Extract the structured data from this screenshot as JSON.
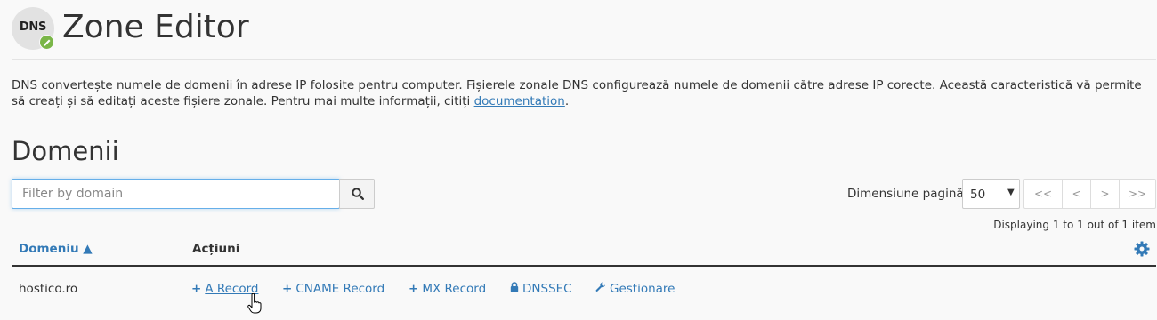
{
  "header": {
    "logo_text": "DNS",
    "title": "Zone Editor"
  },
  "description": {
    "text": "DNS convertește numele de domenii în adrese IP folosite pentru computer. Fișierele zonale DNS configurează numele de domenii către adrese IP corecte. Această caracteristică vă permite să creați și să editați aceste fișiere zonale. Pentru mai multe informații, citiți ",
    "link_text": "documentation",
    "end": "."
  },
  "section": {
    "title": "Domenii"
  },
  "search": {
    "placeholder": "Filter by domain",
    "value": ""
  },
  "pagination": {
    "page_size_label": "Dimensiune pagină",
    "page_size_value": "50",
    "first": "<<",
    "prev": "<",
    "next": ">",
    "last": ">>",
    "displaying": "Displaying 1 to 1 out of 1 item"
  },
  "table": {
    "headers": {
      "domain": "Domeniu ▲",
      "actions": "Acțiuni"
    },
    "rows": [
      {
        "domain": "hostico.ro",
        "actions": [
          {
            "icon": "plus-icon",
            "label": "A Record"
          },
          {
            "icon": "plus-icon",
            "label": "CNAME Record"
          },
          {
            "icon": "plus-icon",
            "label": "MX Record"
          },
          {
            "icon": "lock-icon",
            "label": "DNSSEC"
          },
          {
            "icon": "wrench-icon",
            "label": "Gestionare"
          }
        ]
      }
    ]
  },
  "colors": {
    "link": "#337ab7",
    "badge": "#7ab648",
    "focus": "#66afe9",
    "background": "#f9f9f9"
  }
}
